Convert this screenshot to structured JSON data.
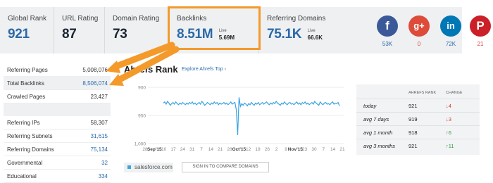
{
  "metrics": [
    {
      "label": "Global Rank",
      "value": "921"
    },
    {
      "label": "URL Rating",
      "value": "87"
    },
    {
      "label": "Domain Rating",
      "value": "73"
    },
    {
      "label": "Backlinks",
      "value": "8.51M",
      "sub_label": "Live",
      "sub_value": "5.69M"
    },
    {
      "label": "Referring Domains",
      "value": "75.1K",
      "sub_label": "Live",
      "sub_value": "66.6K"
    }
  ],
  "social": [
    {
      "icon": "facebook-icon",
      "glyph": "f",
      "color": "#3b5998",
      "count": "53K"
    },
    {
      "icon": "google-plus-icon",
      "glyph": "g+",
      "color": "#dd4b39",
      "count": "0"
    },
    {
      "icon": "linkedin-icon",
      "glyph": "in",
      "color": "#0077b5",
      "count": "72K"
    },
    {
      "icon": "pinterest-icon",
      "glyph": "P",
      "color": "#cb2027",
      "count": "21"
    }
  ],
  "left_table": {
    "group1": [
      {
        "label": "Referring Pages",
        "value": "5,008,076"
      },
      {
        "label": "Total Backlinks",
        "value": "8,506,074"
      },
      {
        "label": "Crawled Pages",
        "value": "23,427"
      }
    ],
    "group2": [
      {
        "label": "Referring IPs",
        "value": "58,307"
      },
      {
        "label": "Referring Subnets",
        "value": "31,615"
      },
      {
        "label": "Referring Domains",
        "value": "75,134"
      },
      {
        "label": "Governmental",
        "value": "32"
      },
      {
        "label": "Educational",
        "value": "334"
      }
    ]
  },
  "chart_header": {
    "title": "Ahrefs Rank",
    "link": "Explore Ahrefs Top ›"
  },
  "chart_data": {
    "type": "line",
    "x_tick_labels": [
      "28",
      "Sep'15",
      "10",
      "17",
      "24",
      "31",
      "7",
      "14",
      "21",
      "28",
      "Oct'15",
      "12",
      "19",
      "26",
      "2",
      "9",
      "Nov'15",
      "23",
      "30",
      "7",
      "14",
      "21"
    ],
    "y_tick_labels": [
      "900",
      "950",
      "1,000"
    ],
    "ylim": [
      1000,
      900
    ],
    "y_inverted": true,
    "values": [
      928,
      926,
      930,
      925,
      928,
      932,
      929,
      927,
      930,
      926,
      929,
      931,
      928,
      930,
      927,
      929,
      931,
      928,
      930,
      927,
      929,
      926,
      930,
      928,
      931,
      929,
      927,
      930,
      925,
      928,
      932,
      930,
      927,
      929,
      931,
      928,
      930,
      926,
      929,
      927,
      931,
      928,
      930,
      929,
      927,
      930,
      928,
      931,
      929,
      926,
      930,
      928,
      927,
      940,
      985,
      918,
      934,
      929,
      932,
      928,
      930,
      933,
      929,
      931,
      927,
      930,
      932,
      928,
      930,
      927,
      931,
      929,
      927,
      930,
      928,
      926,
      929,
      931,
      928,
      930,
      927,
      929,
      925,
      928,
      930,
      932,
      928,
      930,
      926,
      929,
      931,
      928,
      927,
      930,
      929,
      931,
      928,
      926,
      930,
      928,
      931,
      927,
      929,
      926,
      930,
      928,
      931,
      929,
      927,
      930,
      925,
      928,
      930,
      932,
      926,
      929,
      931,
      928,
      927,
      930,
      929,
      931,
      928,
      926,
      930,
      928,
      929,
      927,
      933
    ],
    "color": "#3ca3e0",
    "legend": "salesforce.com"
  },
  "compare_button": "SIGN IN TO COMPARE DOMAINS",
  "rank_table": {
    "headers": [
      "AHREFS RANK",
      "CHANGE"
    ],
    "rows": [
      {
        "period": "today",
        "rank": "921",
        "change": "4",
        "direction": "down"
      },
      {
        "period": "avg 7 days",
        "rank": "919",
        "change": "3",
        "direction": "down"
      },
      {
        "period": "avg 1 month",
        "rank": "918",
        "change": "6",
        "direction": "up"
      },
      {
        "period": "avg 3 months",
        "rank": "921",
        "change": "11",
        "direction": "up"
      }
    ]
  },
  "arrow_color": "#f39a2b"
}
